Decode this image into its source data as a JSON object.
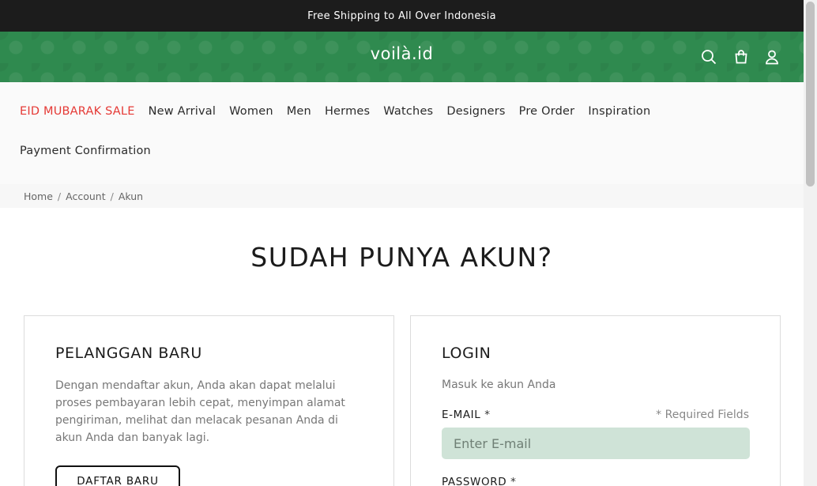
{
  "announcement": "Free Shipping to All Over Indonesia",
  "header": {
    "logo": "voilà.id",
    "icons": [
      "search-icon",
      "bag-icon",
      "user-icon"
    ]
  },
  "nav": {
    "items": [
      {
        "label": "EID MUBARAK SALE",
        "color": "#e53935"
      },
      {
        "label": "New Arrival"
      },
      {
        "label": "Women"
      },
      {
        "label": "Men"
      },
      {
        "label": "Hermes"
      },
      {
        "label": "Watches"
      },
      {
        "label": "Designers"
      },
      {
        "label": "Pre Order"
      },
      {
        "label": "Inspiration"
      },
      {
        "label": "Payment Confirmation"
      }
    ]
  },
  "breadcrumb": [
    "Home",
    "Account",
    "Akun"
  ],
  "page_title": "SUDAH PUNYA AKUN?",
  "new_customer": {
    "title": "PELANGGAN BARU",
    "description": "Dengan mendaftar akun, Anda akan dapat melalui proses pembayaran lebih cepat, menyimpan alamat pengiriman, melihat dan melacak pesanan Anda di akun Anda dan banyak lagi.",
    "button": "DAFTAR BARU"
  },
  "login": {
    "title": "LOGIN",
    "subtitle": "Masuk ke akun Anda",
    "email_label": "E-MAIL",
    "required_star": "*",
    "required_note": "* Required Fields",
    "email_placeholder": "Enter E-mail",
    "email_value": "",
    "password_label": "PASSWORD"
  },
  "colors": {
    "header_green": "#2f8a4f",
    "sale_red": "#e53935",
    "input_bg": "#cfe3d7"
  }
}
